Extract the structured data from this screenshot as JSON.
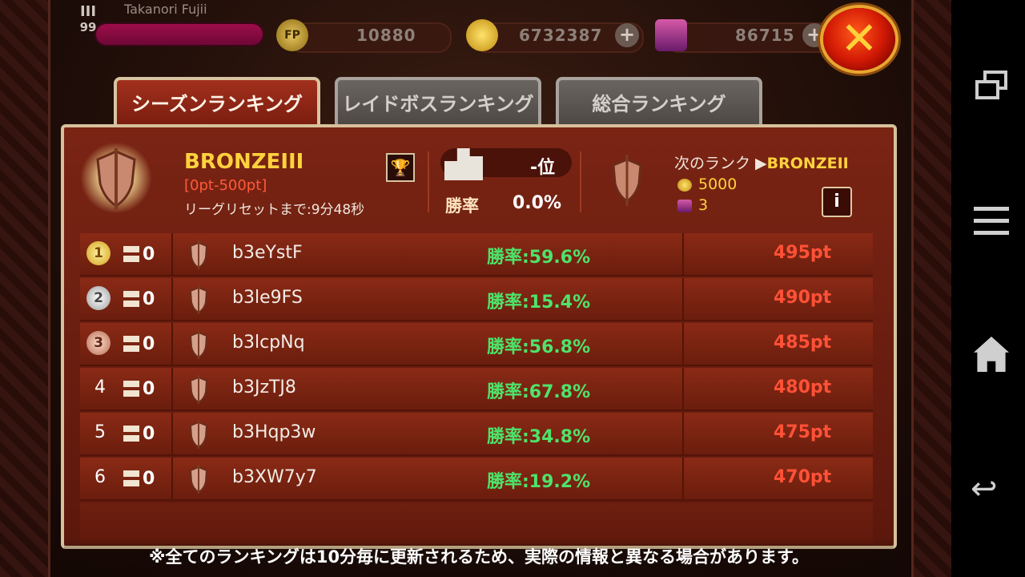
{
  "player": {
    "name": "Takanori Fujii",
    "level_rank": "III",
    "level": "99"
  },
  "currencies": [
    {
      "icon": "fp-icon",
      "value": "10880",
      "has_plus": false
    },
    {
      "icon": "gold-coin-icon",
      "value": "6732387",
      "has_plus": true
    },
    {
      "icon": "gem-chest-icon",
      "value": "86715",
      "has_plus": true
    }
  ],
  "tabs": [
    {
      "label": "シーズンランキング",
      "active": true
    },
    {
      "label": "レイドボスランキング",
      "active": false
    },
    {
      "label": "総合ランキング",
      "active": false
    }
  ],
  "info": {
    "rank_name": "BRONZEIII",
    "rank_range": "[0pt-500pt]",
    "reset_text": "リーグリセットまで:9分48秒",
    "position": "-位",
    "winrate_label": "勝率",
    "winrate_value": "0.0%",
    "next_rank_prefix": "次のランク ▶",
    "next_rank": "BRONZEII",
    "reward_coins": "5000",
    "reward_gems": "3",
    "info_button": "i"
  },
  "rows": [
    {
      "rank": "1",
      "medal": "gold",
      "trend": "0",
      "name": "b3eYstF",
      "winrate": "勝率:59.6%",
      "points": "495pt"
    },
    {
      "rank": "2",
      "medal": "silver",
      "trend": "0",
      "name": "b3le9FS",
      "winrate": "勝率:15.4%",
      "points": "490pt"
    },
    {
      "rank": "3",
      "medal": "bronze",
      "trend": "0",
      "name": "b3lcpNq",
      "winrate": "勝率:56.8%",
      "points": "485pt"
    },
    {
      "rank": "4",
      "medal": "",
      "trend": "0",
      "name": "b3JzTJ8",
      "winrate": "勝率:67.8%",
      "points": "480pt"
    },
    {
      "rank": "5",
      "medal": "",
      "trend": "0",
      "name": "b3Hqp3w",
      "winrate": "勝率:34.8%",
      "points": "475pt"
    },
    {
      "rank": "6",
      "medal": "",
      "trend": "0",
      "name": "b3XW7y7",
      "winrate": "勝率:19.2%",
      "points": "470pt"
    }
  ],
  "footer_note": "※全てのランキングは10分毎に更新されるため、実際の情報と異なる場合があります。",
  "colors": {
    "gold_text": "#ffd23d",
    "winrate_green": "#4ee36a",
    "points_red": "#ff5137",
    "panel_red": "#7a2414"
  }
}
